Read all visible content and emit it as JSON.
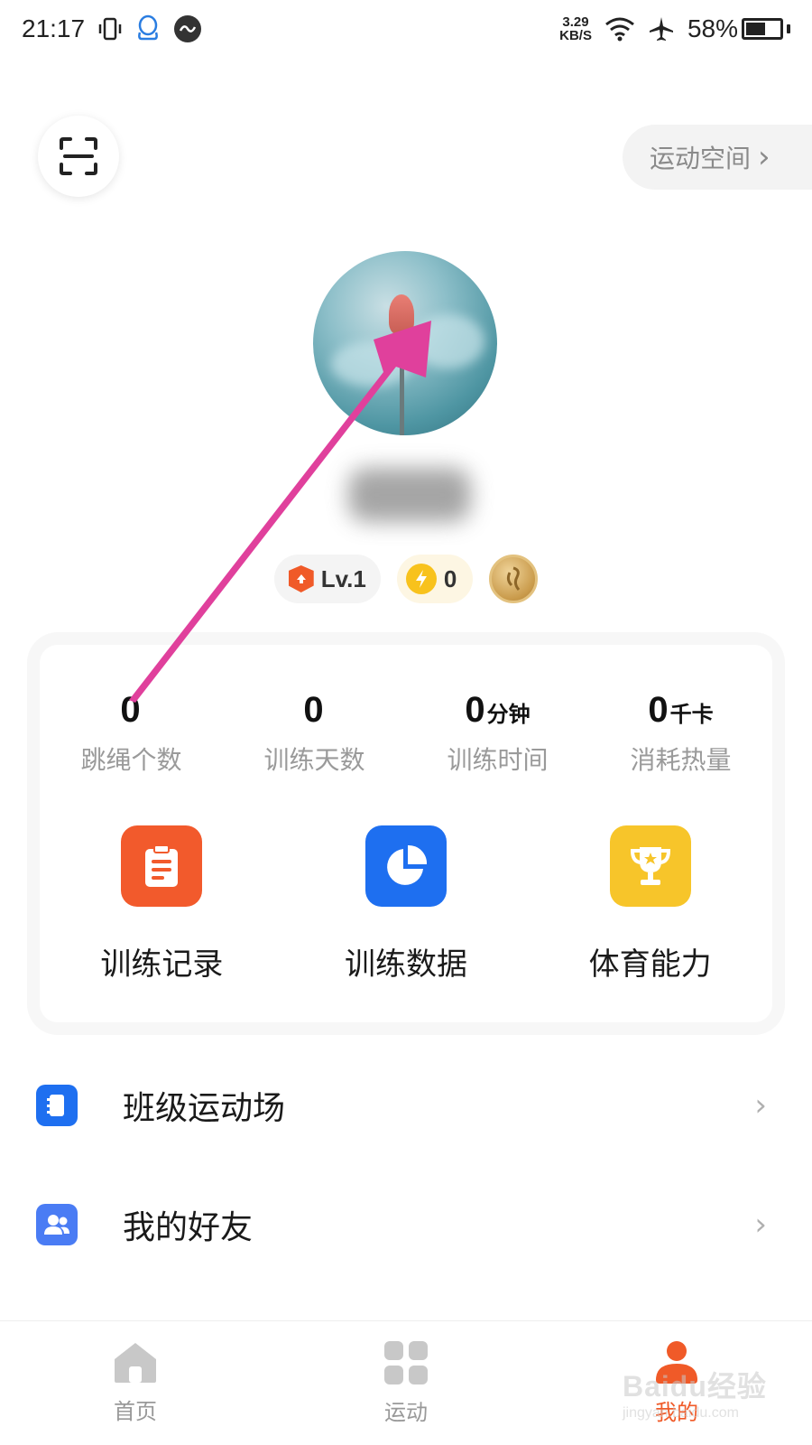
{
  "status_bar": {
    "time": "21:17",
    "speed_value": "3.29",
    "speed_unit": "KB/S",
    "battery": "58%",
    "battery_level": 0.58
  },
  "top_bar": {
    "scan_icon": "scan-icon",
    "space_label": "运动空间",
    "space_chevron": "›"
  },
  "profile": {
    "level": "Lv.1",
    "energy": "0"
  },
  "stats": [
    {
      "value": "0",
      "unit": "",
      "label": "跳绳个数"
    },
    {
      "value": "0",
      "unit": "",
      "label": "训练天数"
    },
    {
      "value": "0",
      "unit": "分钟",
      "label": "训练时间"
    },
    {
      "value": "0",
      "unit": "千卡",
      "label": "消耗热量"
    }
  ],
  "tools": [
    {
      "label": "训练记录",
      "icon": "clipboard-icon",
      "color": "#f25a2c"
    },
    {
      "label": "训练数据",
      "icon": "pie-chart-icon",
      "color": "#1e6ff0"
    },
    {
      "label": "体育能力",
      "icon": "trophy-icon",
      "color": "#f7c52a"
    }
  ],
  "menu": [
    {
      "label": "班级运动场",
      "icon": "notebook-icon",
      "color": "#1e6ff0",
      "chevron": "›"
    },
    {
      "label": "我的好友",
      "icon": "friends-icon",
      "color": "#4a7cf4",
      "chevron": "›"
    }
  ],
  "bottom_nav": [
    {
      "label": "首页",
      "icon": "home-icon",
      "active": false
    },
    {
      "label": "运动",
      "icon": "grid-icon",
      "active": false
    },
    {
      "label": "我的",
      "icon": "profile-icon",
      "active": true
    }
  ],
  "watermark": {
    "main": "Baidu经验",
    "sub": "jingyan.baidu.com"
  },
  "colors": {
    "accent": "#f05a28",
    "annotation_arrow": "#e0409c",
    "inactive_nav": "#c0c0c0"
  }
}
